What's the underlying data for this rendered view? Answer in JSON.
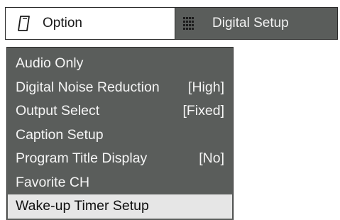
{
  "tabs": {
    "option": {
      "label": "Option",
      "icon": "remote-icon"
    },
    "digital_setup": {
      "label": "Digital Setup",
      "icon": "digital-grid-icon"
    }
  },
  "menu": {
    "items": [
      {
        "label": "Audio Only",
        "value": ""
      },
      {
        "label": "Digital Noise Reduction",
        "value": "[High]"
      },
      {
        "label": "Output Select",
        "value": "[Fixed]"
      },
      {
        "label": "Caption Setup",
        "value": ""
      },
      {
        "label": "Program Title Display",
        "value": "[No]"
      },
      {
        "label": "Favorite CH",
        "value": ""
      },
      {
        "label": "Wake-up Timer Setup",
        "value": "",
        "selected": true
      }
    ]
  },
  "colors": {
    "panel": "#5a5d5b",
    "highlight": "#e6e6e6",
    "text_light": "#f5f5f5",
    "border": "#2a2a2a"
  }
}
